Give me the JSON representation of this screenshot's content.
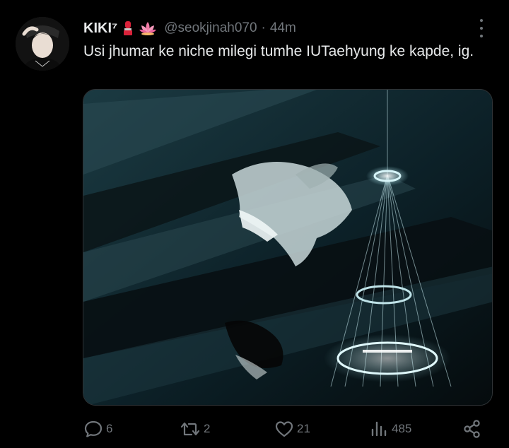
{
  "author": {
    "display_name": "KIKI⁷",
    "name_emojis": [
      "lipstick-emoji",
      "lotus-emoji"
    ],
    "handle": "@seokjinah070",
    "separator": "·",
    "timestamp": "44m"
  },
  "tweet": {
    "text": "Usi jhumar ke niche milegi tumhe IUTaehyung ke kapde, ig."
  },
  "actions": {
    "replies": "6",
    "retweets": "2",
    "likes": "21",
    "views": "485"
  },
  "icons": {
    "reply": "speech-bubble-icon",
    "retweet": "retweet-arrows-icon",
    "like": "heart-icon",
    "views": "bar-chart-icon",
    "share": "share-nodes-icon",
    "more": "vertical-ellipsis-icon"
  },
  "colors": {
    "background": "#000000",
    "text": "#e7e9ea",
    "muted": "#71767b",
    "lipstick": "#d9223a",
    "lotus": "#f27aa6"
  }
}
